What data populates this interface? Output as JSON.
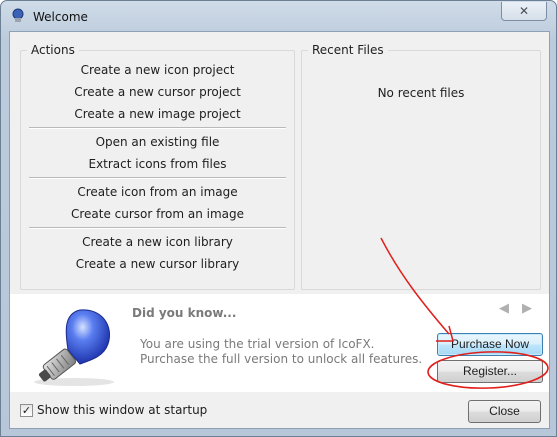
{
  "window": {
    "title": "Welcome",
    "close_glyph": "✕"
  },
  "actions": {
    "title": "Actions",
    "groups": [
      [
        "Create a new icon project",
        "Create a new cursor project",
        "Create a new image project"
      ],
      [
        "Open an existing file",
        "Extract icons from files"
      ],
      [
        "Create icon from an image",
        "Create cursor from an image"
      ],
      [
        "Create a new icon library",
        "Create a new cursor library"
      ]
    ]
  },
  "recent": {
    "title": "Recent Files",
    "empty_text": "No recent files"
  },
  "tips": {
    "heading": "Did you know...",
    "prev_glyph": "◀",
    "next_glyph": "▶",
    "message": "You are using the trial version of IcoFX. Purchase the full version to unlock all features.",
    "purchase_label": "Purchase Now",
    "register_label": "Register..."
  },
  "footer": {
    "startup_label": "Show this window at startup",
    "startup_checked": true,
    "check_glyph": "✓",
    "close_label": "Close"
  },
  "annotation": {
    "color": "#e0201c"
  }
}
